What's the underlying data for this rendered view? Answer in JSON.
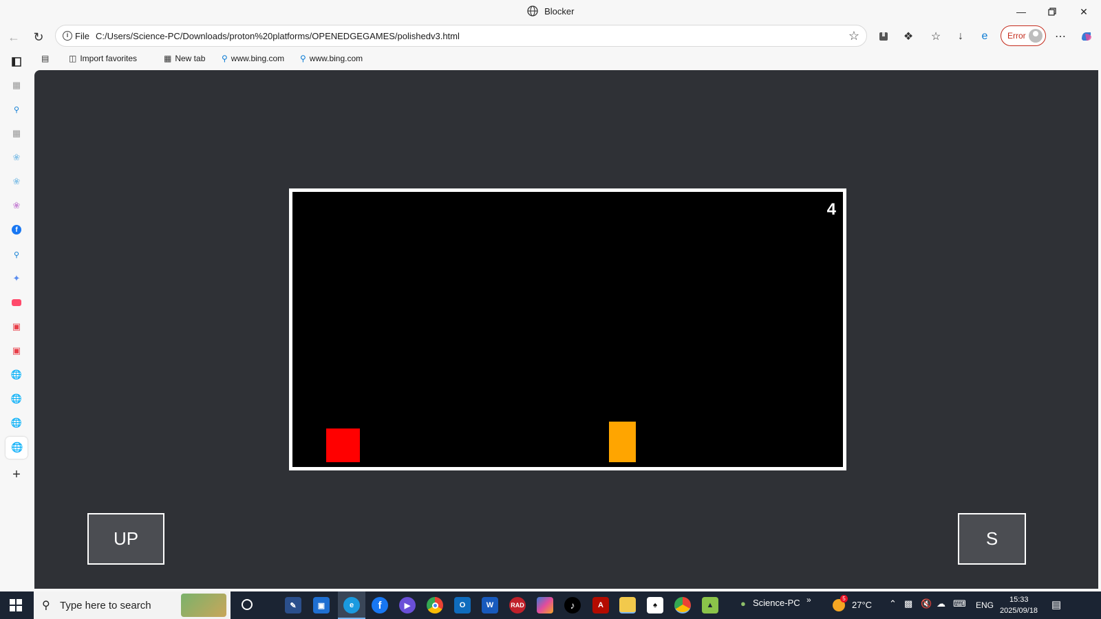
{
  "window": {
    "title": "Blocker"
  },
  "address_bar": {
    "scheme_label": "File",
    "url": "C:/Users/Science-PC/Downloads/proton%20platforms/OPENEDGEGAMES/polishedv3.html"
  },
  "profile": {
    "status_label": "Error"
  },
  "favorites": [
    {
      "label": "Import favorites",
      "icon": "import-icon"
    },
    {
      "label": "New tab",
      "icon": "tab-icon"
    },
    {
      "label": "www.bing.com",
      "icon": "search-icon"
    },
    {
      "label": "www.bing.com",
      "icon": "search-icon"
    }
  ],
  "game": {
    "score": "4",
    "controls": {
      "up_label": "UP",
      "s_label": "S"
    },
    "colors": {
      "background": "#000000",
      "border": "#ffffff",
      "player": "#ff0000",
      "obstacle": "#ffa500",
      "page": "#2f3136"
    }
  },
  "taskbar": {
    "search_placeholder": "Type here to search",
    "user_label": "Science-PC",
    "weather": "27°C",
    "weather_badge": "5",
    "language": "ENG",
    "time": "15:33",
    "date": "2025/09/18",
    "apps": [
      {
        "name": "ROBLOX",
        "label": "RAD"
      }
    ]
  }
}
